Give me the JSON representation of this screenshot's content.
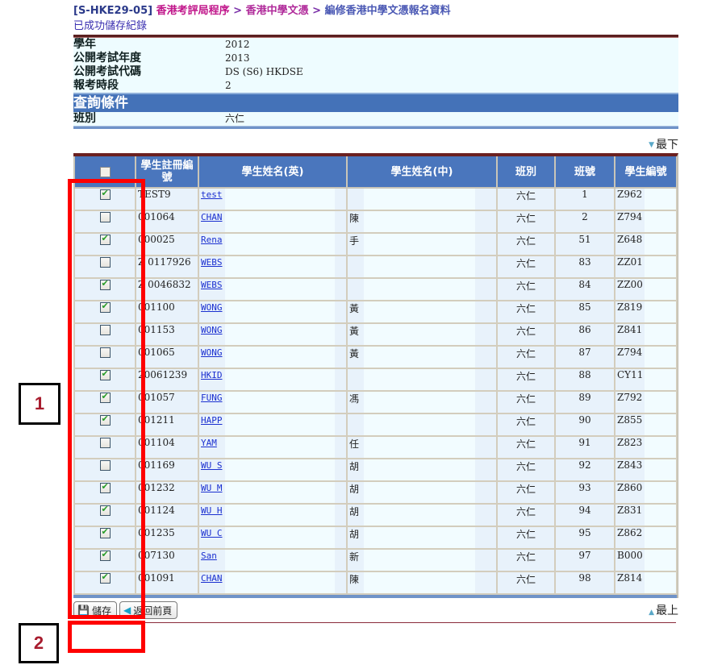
{
  "header": {
    "screen_code": "[S-HKE29-05]",
    "breadcrumb": [
      "香港考評局程序",
      "香港中學文憑",
      "編修香港中學文憑報名資料"
    ],
    "separator": ">",
    "status_message": "已成功儲存紀錄"
  },
  "info": [
    {
      "label": "學年",
      "value": "2012"
    },
    {
      "label": "公開考試年度",
      "value": "2013"
    },
    {
      "label": "公開考試代碼",
      "value": "DS (S6) HKDSE"
    },
    {
      "label": "報考時段",
      "value": "2"
    }
  ],
  "query": {
    "title": "查詢條件",
    "label": "班別",
    "value": "六仁"
  },
  "nav": {
    "to_bottom": "最下",
    "to_top": "最上"
  },
  "table": {
    "columns": [
      "",
      "學生註冊編號",
      "學生姓名(英)",
      "學生姓名(中)",
      "班別",
      "班號",
      "學生編號"
    ],
    "rows": [
      {
        "checked": true,
        "reg_no": "TEST9",
        "name_en": "test",
        "name_zh": "",
        "class": "六仁",
        "class_no": "1",
        "student_id": "Z962"
      },
      {
        "checked": false,
        "reg_no": "001064",
        "name_en": "CHAN",
        "name_zh": "陳",
        "class": "六仁",
        "class_no": "2",
        "student_id": "Z794"
      },
      {
        "checked": true,
        "reg_no": "000025",
        "name_en": "Rena",
        "name_zh": "手",
        "class": "六仁",
        "class_no": "51",
        "student_id": "Z648"
      },
      {
        "checked": false,
        "reg_no": "Z 0117926",
        "name_en": "WEBS",
        "name_zh": "",
        "class": "六仁",
        "class_no": "83",
        "student_id": "ZZ01"
      },
      {
        "checked": true,
        "reg_no": "Z 0046832",
        "name_en": "WEBS",
        "name_zh": "",
        "class": "六仁",
        "class_no": "84",
        "student_id": "ZZ00"
      },
      {
        "checked": true,
        "reg_no": "001100",
        "name_en": "WONG",
        "name_zh": "黃",
        "class": "六仁",
        "class_no": "85",
        "student_id": "Z819"
      },
      {
        "checked": false,
        "reg_no": "001153",
        "name_en": "WONG",
        "name_zh": "黃",
        "class": "六仁",
        "class_no": "86",
        "student_id": "Z841"
      },
      {
        "checked": false,
        "reg_no": "001065",
        "name_en": "WONG",
        "name_zh": "黃",
        "class": "六仁",
        "class_no": "87",
        "student_id": "Z794"
      },
      {
        "checked": true,
        "reg_no": "20061239",
        "name_en": "HKID",
        "name_zh": "",
        "class": "六仁",
        "class_no": "88",
        "student_id": "CY11"
      },
      {
        "checked": true,
        "reg_no": "001057",
        "name_en": "FUNG",
        "name_zh": "馮",
        "class": "六仁",
        "class_no": "89",
        "student_id": "Z792"
      },
      {
        "checked": true,
        "reg_no": "001211",
        "name_en": "HAPP",
        "name_zh": "",
        "class": "六仁",
        "class_no": "90",
        "student_id": "Z855"
      },
      {
        "checked": false,
        "reg_no": "001104",
        "name_en": "YAM",
        "name_zh": "任",
        "class": "六仁",
        "class_no": "91",
        "student_id": "Z823"
      },
      {
        "checked": false,
        "reg_no": "001169",
        "name_en": "WU S",
        "name_zh": "胡",
        "class": "六仁",
        "class_no": "92",
        "student_id": "Z843"
      },
      {
        "checked": true,
        "reg_no": "001232",
        "name_en": "WU M",
        "name_zh": "胡",
        "class": "六仁",
        "class_no": "93",
        "student_id": "Z860"
      },
      {
        "checked": true,
        "reg_no": "001124",
        "name_en": "WU H",
        "name_zh": "胡",
        "class": "六仁",
        "class_no": "94",
        "student_id": "Z831"
      },
      {
        "checked": true,
        "reg_no": "001235",
        "name_en": "WU C",
        "name_zh": "胡",
        "class": "六仁",
        "class_no": "95",
        "student_id": "Z862"
      },
      {
        "checked": true,
        "reg_no": "007130",
        "name_en": "San",
        "name_zh": "新",
        "class": "六仁",
        "class_no": "97",
        "student_id": "B000"
      },
      {
        "checked": true,
        "reg_no": "001091",
        "name_en": "CHAN",
        "name_zh": "陳",
        "class": "六仁",
        "class_no": "98",
        "student_id": "Z814"
      }
    ]
  },
  "footer": {
    "save_label": "儲存",
    "back_label": "返回前頁"
  },
  "annotations": {
    "label_1": "1",
    "label_2": "2",
    "color": "#ff0000"
  }
}
